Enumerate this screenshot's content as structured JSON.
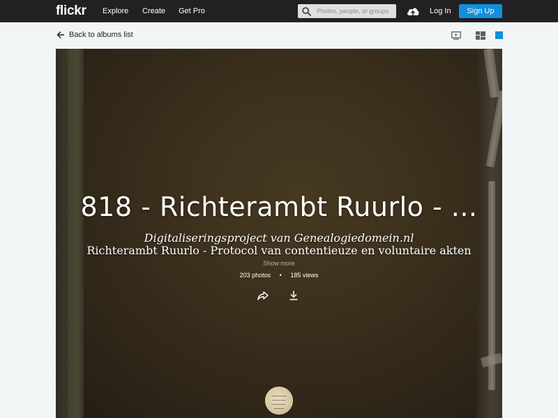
{
  "nav": {
    "logo": "flickr",
    "links": [
      "Explore",
      "Create",
      "Get Pro"
    ],
    "search_placeholder": "Photos, people, or groups",
    "login": "Log In",
    "signup": "Sign Up"
  },
  "subnav": {
    "back_label": "Back to albums list"
  },
  "album": {
    "title": "818 - Richterambt Ruurlo - ...",
    "description_line1": "Digitaliseringsproject van Genealogiedomein.nl",
    "description_line2": "Richterambt Ruurlo - Protocol van contentieuze en voluntaire akten",
    "show_more": "Show more",
    "photos": "203 photos",
    "separator": "•",
    "views": "185 views"
  },
  "colors": {
    "nav_bg": "#212124",
    "accent": "#128fdc",
    "page_bg": "#f2f5f6"
  },
  "icons": [
    "search-icon",
    "upload-cloud-icon",
    "arrow-left-icon",
    "slideshow-icon",
    "grid-view-icon",
    "single-view-icon",
    "share-icon",
    "download-icon"
  ]
}
